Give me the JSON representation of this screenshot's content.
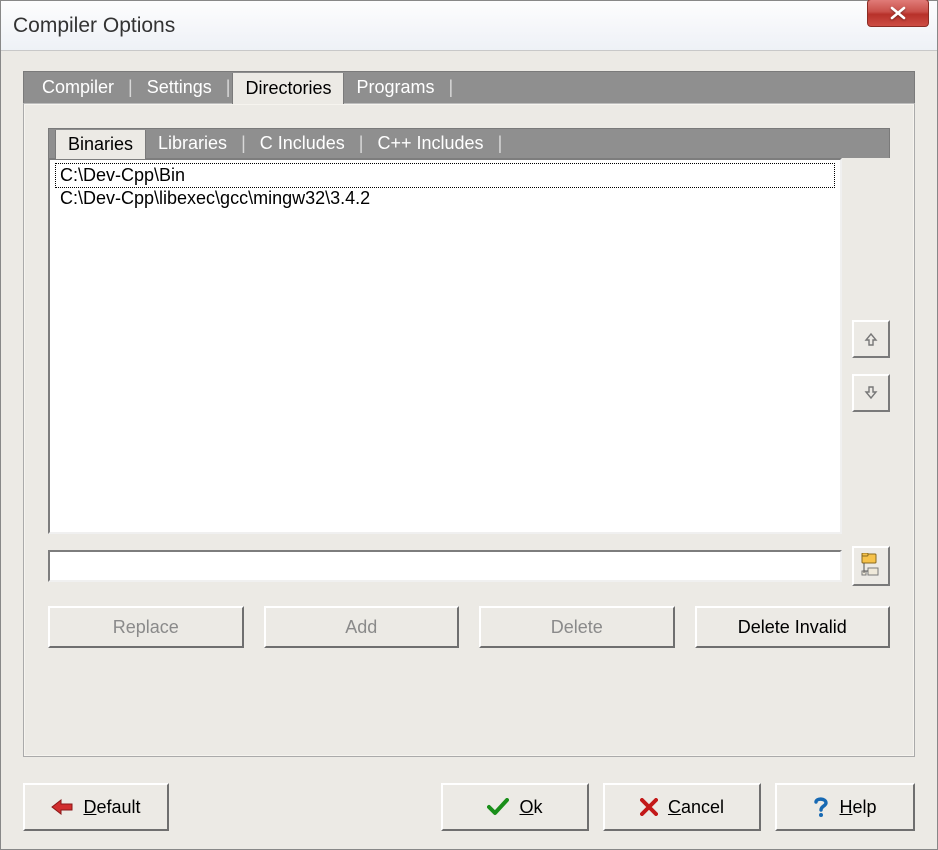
{
  "window": {
    "title": "Compiler Options"
  },
  "tabs": {
    "items": [
      {
        "label": "Compiler",
        "active": false
      },
      {
        "label": "Settings",
        "active": false
      },
      {
        "label": "Directories",
        "active": true
      },
      {
        "label": "Programs",
        "active": false
      }
    ]
  },
  "subtabs": {
    "items": [
      {
        "label": "Binaries",
        "active": true
      },
      {
        "label": "Libraries",
        "active": false
      },
      {
        "label": "C Includes",
        "active": false
      },
      {
        "label": "C++ Includes",
        "active": false
      }
    ]
  },
  "directories": {
    "items": [
      "C:\\Dev-Cpp\\Bin",
      "C:\\Dev-Cpp\\libexec\\gcc\\mingw32\\3.4.2"
    ],
    "selected_index": 0
  },
  "path_input": {
    "value": ""
  },
  "buttons": {
    "replace": "Replace",
    "add": "Add",
    "delete": "Delete",
    "delete_invalid": "Delete Invalid",
    "default": "Default",
    "ok": "Ok",
    "cancel": "Cancel",
    "help": "Help"
  },
  "icons": {
    "close": "close-icon",
    "up": "arrow-up-icon",
    "down": "arrow-down-icon",
    "browse": "folder-tree-icon",
    "default": "arrow-left-red-icon",
    "ok": "check-green-icon",
    "cancel": "x-red-icon",
    "help": "question-blue-icon"
  }
}
